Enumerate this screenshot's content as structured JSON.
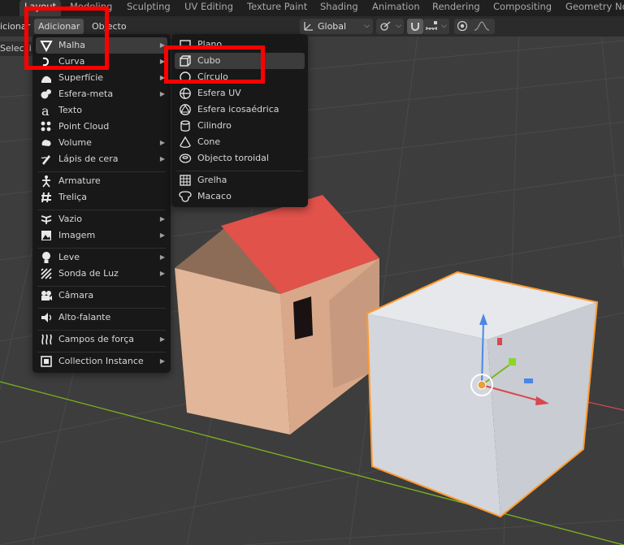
{
  "workspace_tabs": [
    "Layout",
    "Modeling",
    "Sculpting",
    "UV Editing",
    "Texture Paint",
    "Shading",
    "Animation",
    "Rendering",
    "Compositing",
    "Geometry Nodes"
  ],
  "header": {
    "menu_cut": "icionar",
    "add_menu": "Adicionar",
    "object_menu": "Objecto",
    "transform_orientation": "Global",
    "select_cut": "Selecci"
  },
  "add_menu_items": [
    {
      "label": "Malha",
      "icon": "mesh-icon",
      "submenu": true
    },
    {
      "label": "Curva",
      "icon": "curve-icon",
      "submenu": true
    },
    {
      "label": "Superfície",
      "icon": "surface-icon",
      "submenu": true
    },
    {
      "label": "Esfera-meta",
      "icon": "metaball-icon",
      "submenu": true
    },
    {
      "label": "Texto",
      "icon": "text-icon",
      "submenu": false
    },
    {
      "label": "Point Cloud",
      "icon": "point-cloud-icon",
      "submenu": false
    },
    {
      "label": "Volume",
      "icon": "volume-icon",
      "submenu": true
    },
    {
      "label": "Lápis de cera",
      "icon": "grease-pencil-icon",
      "submenu": true
    },
    {
      "label": "Armature",
      "icon": "armature-icon",
      "submenu": false
    },
    {
      "label": "Treliça",
      "icon": "lattice-icon",
      "submenu": false
    },
    {
      "label": "Vazio",
      "icon": "empty-icon",
      "submenu": true
    },
    {
      "label": "Imagem",
      "icon": "image-icon",
      "submenu": true
    },
    {
      "label": "Leve",
      "icon": "light-icon",
      "submenu": true
    },
    {
      "label": "Sonda de Luz",
      "icon": "light-probe-icon",
      "submenu": true
    },
    {
      "label": "Câmara",
      "icon": "camera-icon",
      "submenu": false
    },
    {
      "label": "Alto-falante",
      "icon": "speaker-icon",
      "submenu": false
    },
    {
      "label": "Campos de força",
      "icon": "force-field-icon",
      "submenu": true
    },
    {
      "label": "Collection Instance",
      "icon": "collection-icon",
      "submenu": true
    }
  ],
  "mesh_menu_items": [
    {
      "label": "Plano",
      "icon": "plane-icon"
    },
    {
      "label": "Cubo",
      "icon": "cube-icon"
    },
    {
      "label": "Círculo",
      "icon": "circle-icon"
    },
    {
      "label": "Esfera UV",
      "icon": "uv-sphere-icon"
    },
    {
      "label": "Esfera icosaédrica",
      "icon": "ico-sphere-icon"
    },
    {
      "label": "Cilindro",
      "icon": "cylinder-icon"
    },
    {
      "label": "Cone",
      "icon": "cone-icon"
    },
    {
      "label": "Objecto toroidal",
      "icon": "torus-icon"
    },
    {
      "label": "Grelha",
      "icon": "grid-icon"
    },
    {
      "label": "Macaco",
      "icon": "monkey-icon"
    }
  ],
  "colors": {
    "highlight_box": "#ff0000",
    "selection_outline": "#ff9a2e",
    "roof": "#e0524a",
    "house_wall": "#e2b699",
    "cube_face": "#d8dce3",
    "x_axis": "#d9474f",
    "y_axis": "#7ab51d"
  }
}
